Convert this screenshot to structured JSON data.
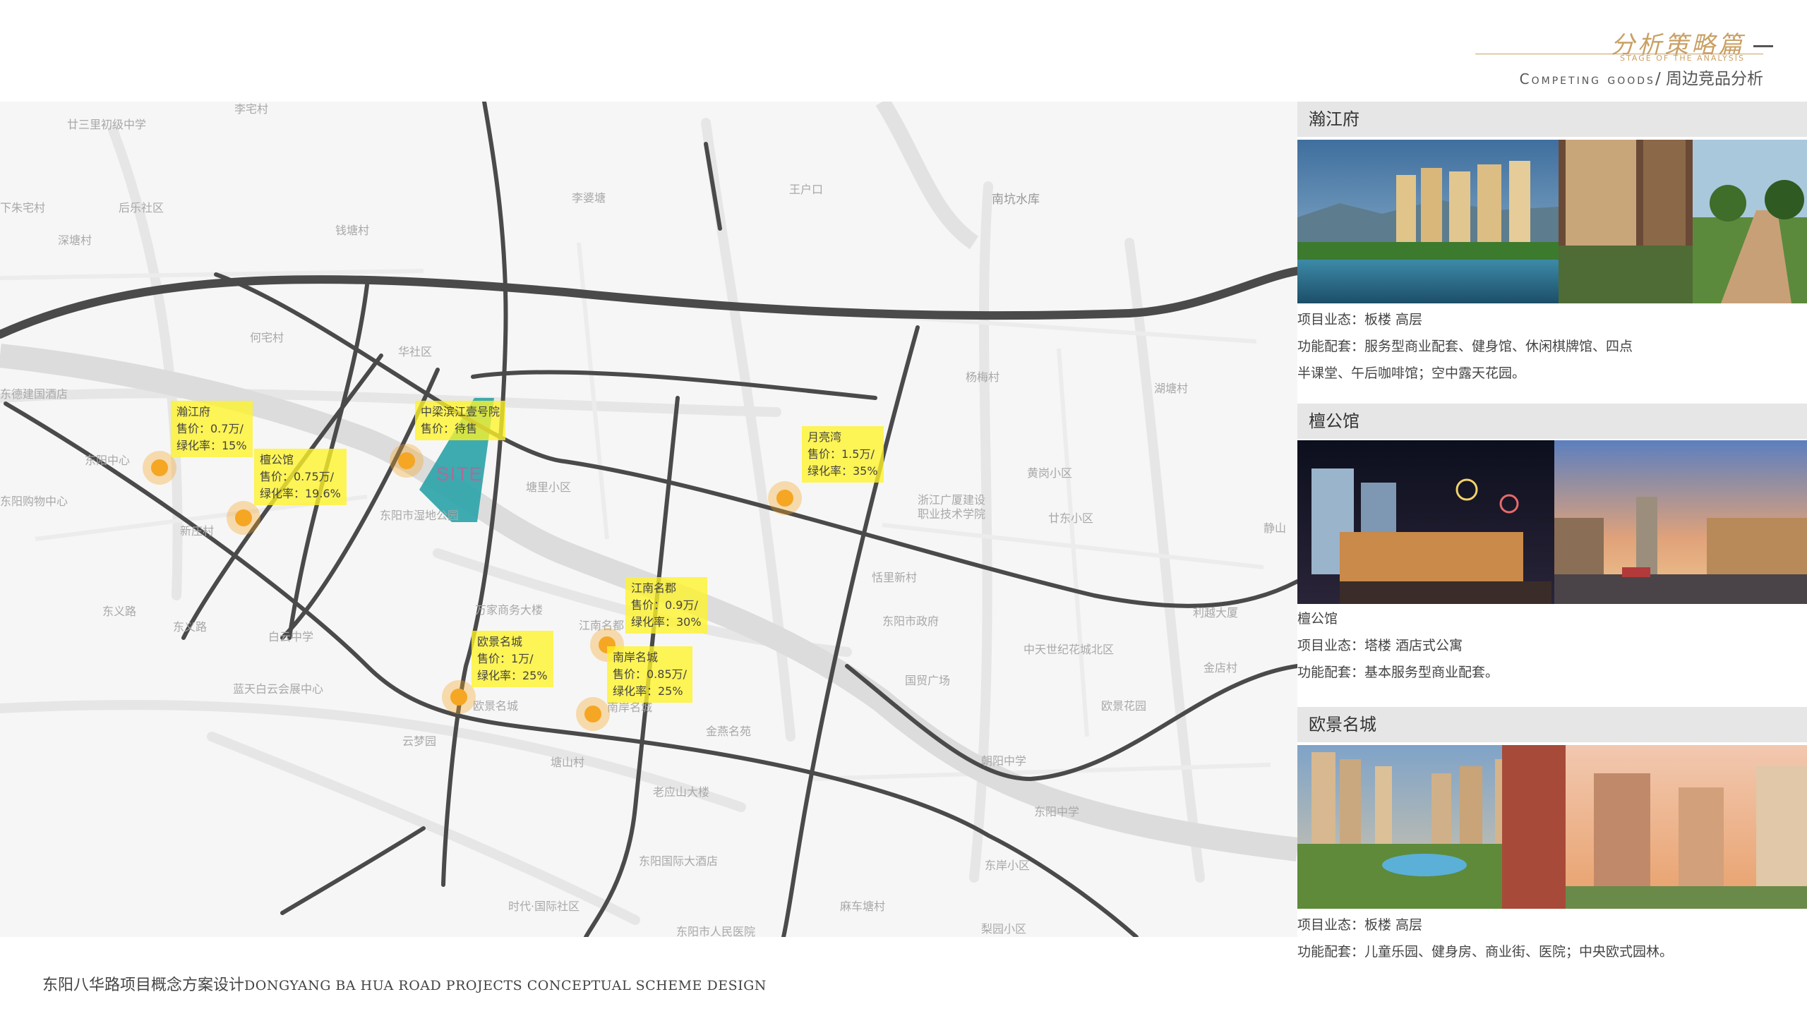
{
  "header": {
    "brand_cn": "分析策略篇",
    "brand_en": "STAGE OF THE ANALYSIS",
    "subtitle_en": "Competing goods",
    "subtitle_cn": "/ 周边竞品分析"
  },
  "map": {
    "site_label": "SITE",
    "places": [
      "廿三里初级中学",
      "李宅村",
      "下朱宅村",
      "后乐社区",
      "深塘村",
      "钱塘村",
      "李婆塘",
      "王户口",
      "南坑水库",
      "何宅村",
      "华社区",
      "东德建国酒店",
      "东阳中心",
      "东阳购物中心",
      "新庄村",
      "东阳市湿地公园",
      "塘里小区",
      "万家商务大楼",
      "东义路",
      "白云中学",
      "蓝天白云会展中心",
      "云梦园",
      "欧景名城",
      "江南名都",
      "南岸名城",
      "金燕名苑",
      "塘山村",
      "老应山大楼",
      "东阳国际大酒店",
      "时代·国际社区",
      "东阳市人民医院",
      "梨园小区",
      "东阳中学",
      "东岸小区",
      "东阳市政府",
      "国贸广场",
      "恬里新村",
      "黄岗小区",
      "廿东小区",
      "浙江广厦建设职业技术学院",
      "中天世纪花城北区",
      "欧景花园",
      "静山",
      "利越大厦",
      "金店村",
      "杨梅村",
      "湖塘村",
      "朝阳中学",
      "麻车塘村"
    ]
  },
  "tags": [
    {
      "name": "瀚江府",
      "price": "售价：0.7万/",
      "green": "绿化率：15%"
    },
    {
      "name": "檀公馆",
      "price": "售价：0.75万/",
      "green": "绿化率：19.6%"
    },
    {
      "name": "中梁滨江壹号院",
      "price": "售价：待售"
    },
    {
      "name": "月亮湾",
      "price": "售价：1.5万/",
      "green": "绿化率：35%"
    },
    {
      "name": "江南名郡",
      "price": "售价：0.9万/",
      "green": "绿化率：30%"
    },
    {
      "name": "欧景名城",
      "price": "售价：1万/",
      "green": "绿化率：25%"
    },
    {
      "name": "南岸名城",
      "price": "售价：0.85万/",
      "green": "绿化率：25%"
    }
  ],
  "panels": [
    {
      "title": "瀚江府",
      "caption": "",
      "type": "项目业态：板楼 高层",
      "features1": "功能配套：服务型商业配套、健身馆、休闲棋牌馆、四点",
      "features2": "半课堂、午后咖啡馆；空中露天花园。"
    },
    {
      "title": "檀公馆",
      "caption": "檀公馆",
      "type": "项目业态：塔楼 酒店式公寓",
      "features1": "功能配套：基本服务型商业配套。",
      "features2": ""
    },
    {
      "title": "欧景名城",
      "caption": "",
      "type": "项目业态：板楼 高层",
      "features1": "功能配套：儿童乐园、健身房、商业街、医院；中央欧式园林。",
      "features2": ""
    }
  ],
  "footer": {
    "cn": "东阳八华路项目概念方案设计",
    "en": "DONGYANG BA HUA ROAD PROJECTS CONCEPTUAL SCHEME DESIGN"
  },
  "colors": {
    "accent_gold": "#c9a064",
    "tag_yellow": "#fff428",
    "marker_orange": "#f5a623",
    "site_teal": "#2aa3a8",
    "road": "#4a4a4a"
  }
}
